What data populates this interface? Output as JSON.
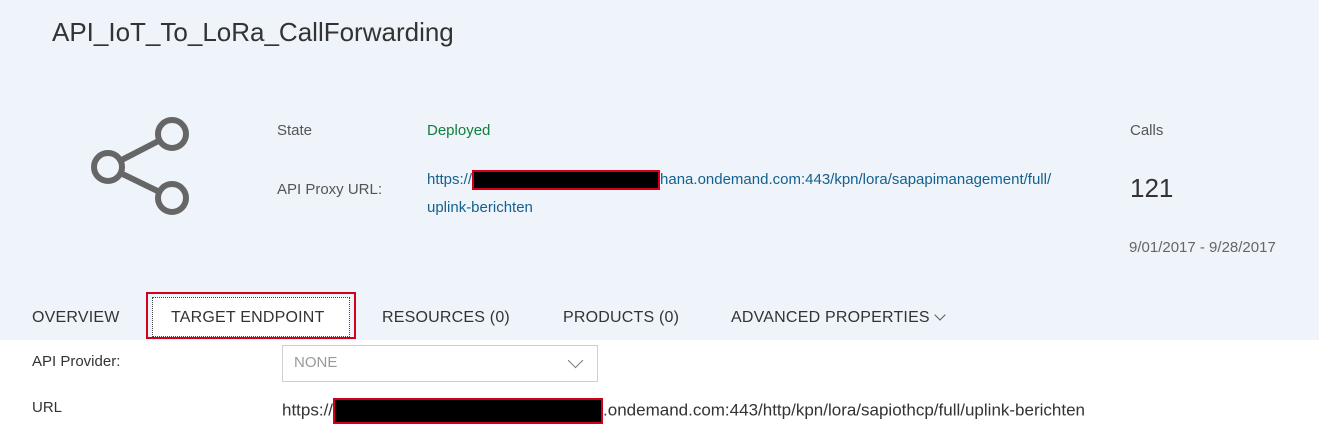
{
  "header": {
    "title": "API_IoT_To_LoRa_CallForwarding",
    "icon": "share-icon",
    "state_label": "State",
    "state_value": "Deployed",
    "state_color": "#107e3e",
    "proxy_url_label": "API Proxy URL:",
    "proxy_url_prefix": "https://",
    "proxy_url_line1_suffix": "hana.ondemand.com:443/kpn/lora/sapapimanagement/full/",
    "proxy_url_line2": "uplink-berichten",
    "calls_label": "Calls",
    "calls_value": "121",
    "date_range": "9/01/2017 - 9/28/2017"
  },
  "tabs": [
    {
      "label": "OVERVIEW"
    },
    {
      "label": "TARGET ENDPOINT",
      "active": true
    },
    {
      "label": "RESOURCES (0)"
    },
    {
      "label": "PRODUCTS (0)"
    },
    {
      "label": "ADVANCED PROPERTIES"
    }
  ],
  "target": {
    "provider_label": "API Provider:",
    "provider_value": "NONE",
    "url_label": "URL",
    "url_prefix": "https://",
    "url_suffix": ".ondemand.com:443/http/kpn/lora/sapiothcp/full/uplink-berichten"
  },
  "colors": {
    "header_bg": "#eef4f9",
    "link": "#15608f",
    "highlight": "#d0021b"
  }
}
